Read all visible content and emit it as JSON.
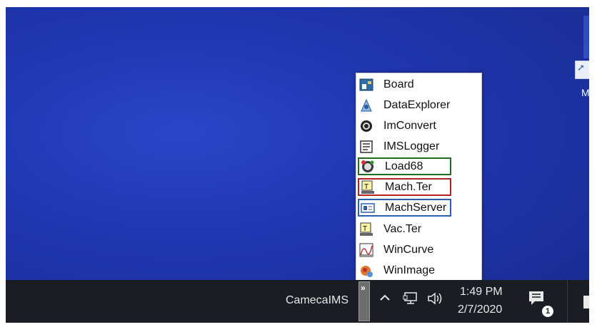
{
  "desktop": {
    "shortcut_label": "M"
  },
  "menu": {
    "items": [
      {
        "label": "Board",
        "icon": "board-icon"
      },
      {
        "label": "DataExplorer",
        "icon": "data-explorer-icon"
      },
      {
        "label": "ImConvert",
        "icon": "imconvert-icon"
      },
      {
        "label": "IMSLogger",
        "icon": "logger-icon"
      },
      {
        "label": "Load68",
        "icon": "load68-icon",
        "highlight": "#1f6e1f"
      },
      {
        "label": "Mach.Ter",
        "icon": "terminal-icon",
        "highlight": "#b02020"
      },
      {
        "label": "MachServer",
        "icon": "server-icon",
        "highlight": "#2a5fb8"
      },
      {
        "label": "Vac.Ter",
        "icon": "terminal-icon"
      },
      {
        "label": "WinCurve",
        "icon": "curve-icon"
      },
      {
        "label": "WinImage",
        "icon": "image-icon"
      }
    ]
  },
  "taskbar": {
    "app_label": "CamecaIMS",
    "expand_glyph": "»",
    "time": "1:49 PM",
    "date": "2/7/2020",
    "notification_count": "1",
    "icons": [
      "chevron-up-icon",
      "network-icon",
      "speaker-icon",
      "notification-icon"
    ]
  },
  "colors": {
    "desktop_blue": "#1f35ae",
    "taskbar": "#1b1d24",
    "highlight_green": "#1f6e1f",
    "highlight_red": "#b02020",
    "highlight_blue": "#2a5fb8"
  }
}
